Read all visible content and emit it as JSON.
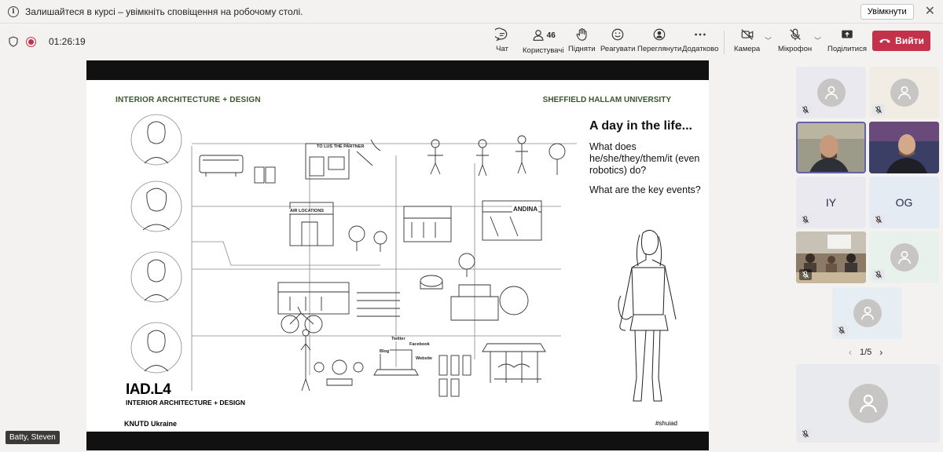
{
  "notification": {
    "text": "Залишайтеся в курсі – увімкніть сповіщення на робочому столі.",
    "enable_label": "Увімкнути",
    "close_glyph": "✕"
  },
  "meeting": {
    "timer": "01:26:19"
  },
  "toolbar": {
    "chat": "Чат",
    "people": "Користувачі",
    "people_count": "46",
    "raise": "Підняти",
    "react": "Реагувати",
    "view": "Переглянути",
    "more": "Додатково",
    "camera": "Камера",
    "mic": "Мікрофон",
    "share": "Поділитися",
    "leave": "Вийти"
  },
  "slide": {
    "header_left": "INTERIOR ARCHITECTURE + DESIGN",
    "header_right": "SHEFFIELD HALLAM UNIVERSITY",
    "title": "A day in the life...",
    "question1": "What does he/she/they/them/it (even robotics) do?",
    "question2": "What are the key events?",
    "logo": "IAD.L4",
    "logo_sub": "INTERIOR ARCHITECTURE + DESIGN",
    "footer_left": "KNUTD Ukraine",
    "footer_right": "#shuiad",
    "sketch_labels": {
      "partner": "TO LUS THE PARTNER",
      "locations": "AIR LOCATIONS",
      "andina": "ANDINA",
      "twitter": "Twitter",
      "facebook": "Facebook",
      "blog": "Blog",
      "website": "Website"
    }
  },
  "participants": {
    "initials_1": "IY",
    "initials_2": "OG",
    "pager": "1/5",
    "prev": "‹",
    "next": "›"
  },
  "presenter_name": "Batty, Steven",
  "colors": {
    "accent_red": "#c4314b",
    "slide_green": "#3b5530",
    "tile_bg": "#ebe9f0"
  }
}
